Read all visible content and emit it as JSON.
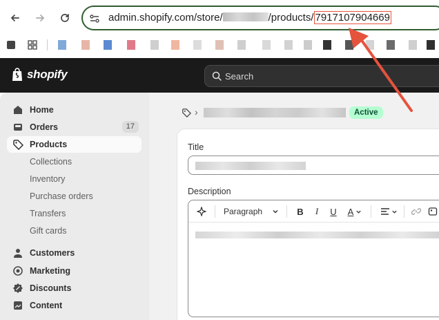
{
  "browser": {
    "url_prefix": "admin.shopify.com/store/",
    "url_mid": "/products/",
    "product_id": "7917107904669"
  },
  "header": {
    "brand": "shopify",
    "search_placeholder": "Search"
  },
  "sidebar": {
    "items": [
      {
        "label": "Home",
        "icon": "home-icon"
      },
      {
        "label": "Orders",
        "icon": "orders-icon",
        "badge": "17"
      },
      {
        "label": "Products",
        "icon": "tag-icon",
        "active": true
      },
      {
        "label": "Collections"
      },
      {
        "label": "Inventory"
      },
      {
        "label": "Purchase orders"
      },
      {
        "label": "Transfers"
      },
      {
        "label": "Gift cards"
      },
      {
        "label": "Customers",
        "icon": "person-icon"
      },
      {
        "label": "Marketing",
        "icon": "target-icon"
      },
      {
        "label": "Discounts",
        "icon": "discount-icon"
      },
      {
        "label": "Content",
        "icon": "content-icon"
      }
    ]
  },
  "main": {
    "breadcrumb_sep": "›",
    "status": "Active",
    "title_label": "Title",
    "description_label": "Description",
    "editor": {
      "paragraph": "Paragraph"
    }
  },
  "colors": {
    "annotation": "#e5533d",
    "header_bg": "#1a1a1a",
    "active_badge_bg": "#b4fed2",
    "active_badge_text": "#0c5132"
  }
}
